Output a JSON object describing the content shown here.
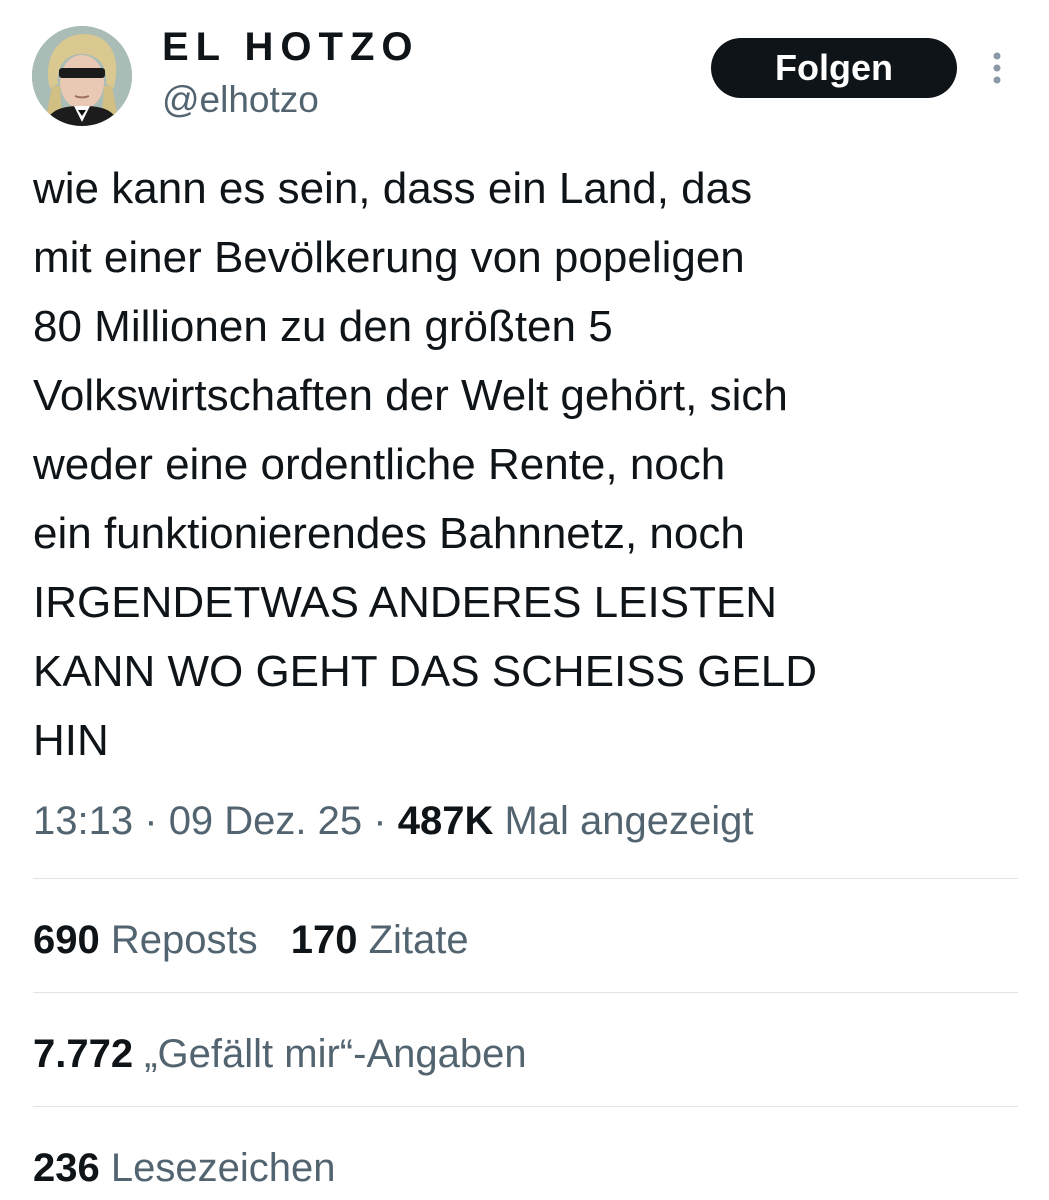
{
  "author": {
    "display_name": "EL HOTZO",
    "handle": "@elhotzo",
    "avatar_icon": "profile-avatar"
  },
  "follow_button": {
    "label": "Folgen"
  },
  "more_icon": "more-options-icon",
  "tweet": {
    "text": "wie kann es sein, dass ein Land, das\nmit einer Bevölkerung von popeligen\n80 Millionen zu den größten 5\nVolkswirtschaften der Welt gehört, sich\nweder eine ordentliche Rente, noch\nein funktionierendes Bahnnetz, noch\nIRGENDETWAS ANDERES LEISTEN\nKANN WO GEHT DAS SCHEISS GELD\nHIN"
  },
  "meta": {
    "time": "13:13",
    "separator": "·",
    "date": "09 Dez. 25",
    "views_count": "487K",
    "views_label": "Mal angezeigt"
  },
  "stats": {
    "reposts": {
      "count": "690",
      "label": "Reposts"
    },
    "quotes": {
      "count": "170",
      "label": "Zitate"
    },
    "likes": {
      "count": "7.772",
      "label": "„Gefällt mir“-Angaben"
    },
    "bookmarks": {
      "count": "236",
      "label": "Lesezeichen"
    }
  },
  "colors": {
    "text_primary": "#0f1419",
    "text_secondary": "#536471",
    "divider": "#dfe3e6",
    "button_bg": "#0f1419",
    "button_text": "#ffffff"
  }
}
